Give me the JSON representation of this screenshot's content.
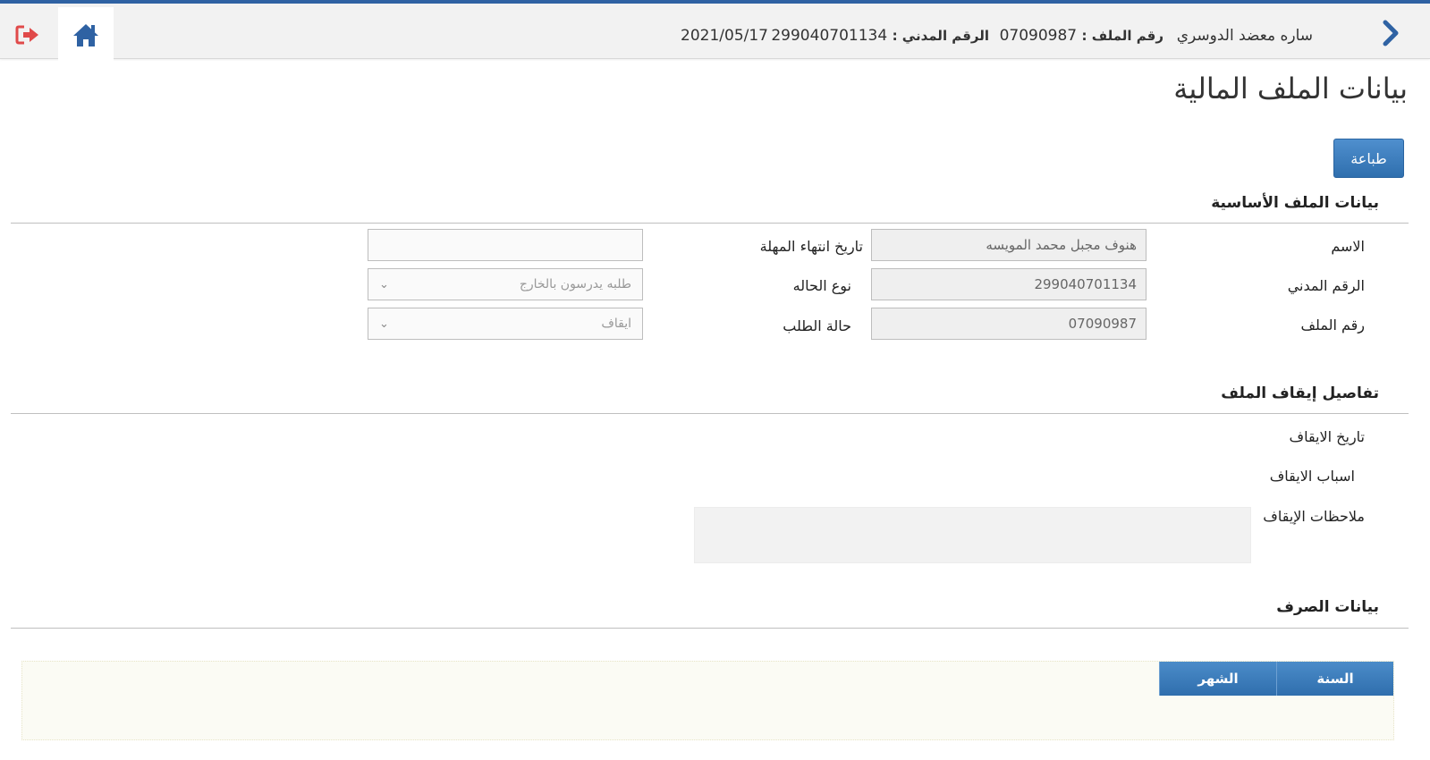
{
  "header": {
    "user_name": "ساره معضد الدوسري",
    "file_no_label": "رقم الملف :",
    "file_no_value": "07090987",
    "civil_id_label": "الرقم المدني :",
    "civil_id_value": "299040701134",
    "date": "2021/05/17",
    "icons": {
      "back": "chevron-right-icon",
      "home": "home-icon",
      "logout": "sign-out-icon"
    },
    "colors": {
      "accent": "#2f62a3",
      "logout": "#e04a4a"
    }
  },
  "page": {
    "title": "بيانات الملف المالية",
    "print_label": "طباعة"
  },
  "basic_section": {
    "title": "بيانات الملف الأساسية",
    "name_label": "الاسم",
    "name_value": "هنوف مجبل محمد المويسه",
    "civil_label": "الرقم المدني",
    "civil_value": "299040701134",
    "file_label": "رقم الملف",
    "file_value": "07090987",
    "deadline_label": "تاريخ انتهاء المهلة",
    "deadline_value": "",
    "case_type_label": "نوع الحاله",
    "case_type_value": "طلبه يدرسون بالخارج",
    "request_status_label": "حالة الطلب",
    "request_status_value": "ايقاف"
  },
  "suspension_section": {
    "title": "تفاصيل إيقاف الملف",
    "date_label": "تاريخ الايقاف",
    "reasons_label": "اسباب الايقاف",
    "notes_label": "ملاحظات الإيقاف"
  },
  "payment_section": {
    "title": "بيانات الصرف",
    "columns": [
      "السنة",
      "الشهر"
    ]
  }
}
